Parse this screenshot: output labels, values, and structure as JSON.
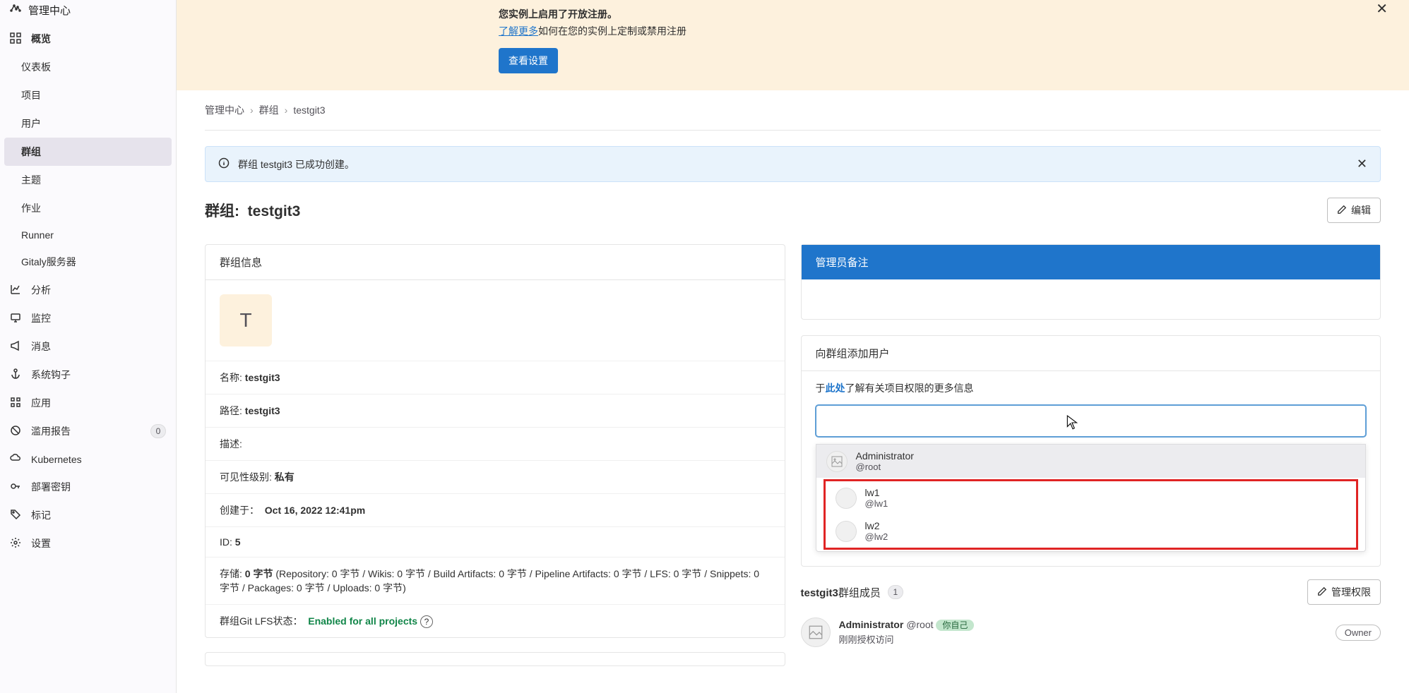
{
  "sidebar": {
    "header": "管理中心",
    "overview": "概览",
    "sub": [
      "仪表板",
      "项目",
      "用户",
      "群组",
      "主题",
      "作业",
      "Runner",
      "Gitaly服务器"
    ],
    "items": {
      "analytics": "分析",
      "monitoring": "监控",
      "messages": "消息",
      "hooks": "系统钩子",
      "apps": "应用",
      "abuse": "滥用报告",
      "abuse_count": "0",
      "k8s": "Kubernetes",
      "deploy_keys": "部署密钥",
      "labels": "标记",
      "settings": "设置"
    }
  },
  "banner": {
    "title_partial": "您实例上启用了开放注册。",
    "link": "了解更多",
    "text_after_link": "如何在您的实例上定制或禁用注册",
    "button": "查看设置"
  },
  "breadcrumbs": {
    "a": "管理中心",
    "b": "群组",
    "c": "testgit3"
  },
  "alert": {
    "msg": "群组 testgit3 已成功创建。"
  },
  "title": {
    "prefix": "群组:",
    "name": "testgit3",
    "edit": "编辑"
  },
  "group_info": {
    "header": "群组信息",
    "avatar_letter": "T",
    "name_label": "名称:",
    "name_value": "testgit3",
    "path_label": "路径:",
    "path_value": "testgit3",
    "desc_label": "描述:",
    "vis_label": "可见性级别:",
    "vis_value": "私有",
    "created_label": "创建于：",
    "created_value": "Oct 16, 2022 12:41pm",
    "id_label": "ID:",
    "id_value": "5",
    "storage_label": "存储:",
    "storage_bold": "0 字节",
    "storage_detail": " (Repository: 0 字节 / Wikis: 0 字节 / Build Artifacts: 0 字节 / Pipeline Artifacts: 0 字节 / LFS: 0 字节 / Snippets: 0 字节 / Packages: 0 字节 / Uploads: 0 字节)",
    "lfs_label": "群组Git LFS状态：",
    "lfs_value": "Enabled for all projects"
  },
  "admin_note": {
    "header": "管理员备注"
  },
  "add_user": {
    "header": "向群组添加用户",
    "perm_prefix": "于",
    "perm_link": "此处",
    "perm_suffix": "了解有关项目权限的更多信息",
    "options": [
      {
        "name": "Administrator",
        "handle": "@root"
      },
      {
        "name": "lw1",
        "handle": "@lw1"
      },
      {
        "name": "lw2",
        "handle": "@lw2"
      }
    ]
  },
  "members": {
    "title_group": "testgit3",
    "title_suffix": "群组成员",
    "count": "1",
    "manage_btn": "管理权限",
    "user_name": "Administrator",
    "user_handle": "@root",
    "self_chip": "你自己",
    "role": "Owner",
    "subline": "刚刚授权访问"
  }
}
